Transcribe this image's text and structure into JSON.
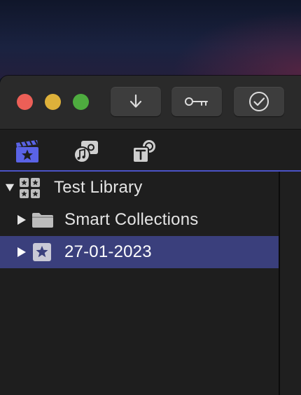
{
  "toolbar": {
    "traffic_lights": [
      {
        "name": "close",
        "color": "#ec5f57"
      },
      {
        "name": "minimize",
        "color": "#deb13a"
      },
      {
        "name": "zoom",
        "color": "#4eac3f"
      }
    ],
    "buttons": [
      {
        "icon": "download-arrow-icon"
      },
      {
        "icon": "key-icon"
      },
      {
        "icon": "checkmark-circle-icon"
      }
    ]
  },
  "browser_tabs": [
    {
      "icon": "clapperboard-star-icon",
      "selected": true
    },
    {
      "icon": "photos-music-icon",
      "selected": false
    },
    {
      "icon": "titles-generators-icon",
      "selected": false
    }
  ],
  "sidebar": {
    "items": [
      {
        "label": "Test Library",
        "icon": "library-icon",
        "expanded": true,
        "selected": false
      },
      {
        "label": "Smart Collections",
        "icon": "folder-icon",
        "expanded": false,
        "selected": false
      },
      {
        "label": "27-01-2023",
        "icon": "event-star-icon",
        "expanded": false,
        "selected": true
      }
    ]
  },
  "colors": {
    "selection": "#3a3f7c",
    "tab_accent": "#4b53c7",
    "background": "#1e1e1e"
  }
}
